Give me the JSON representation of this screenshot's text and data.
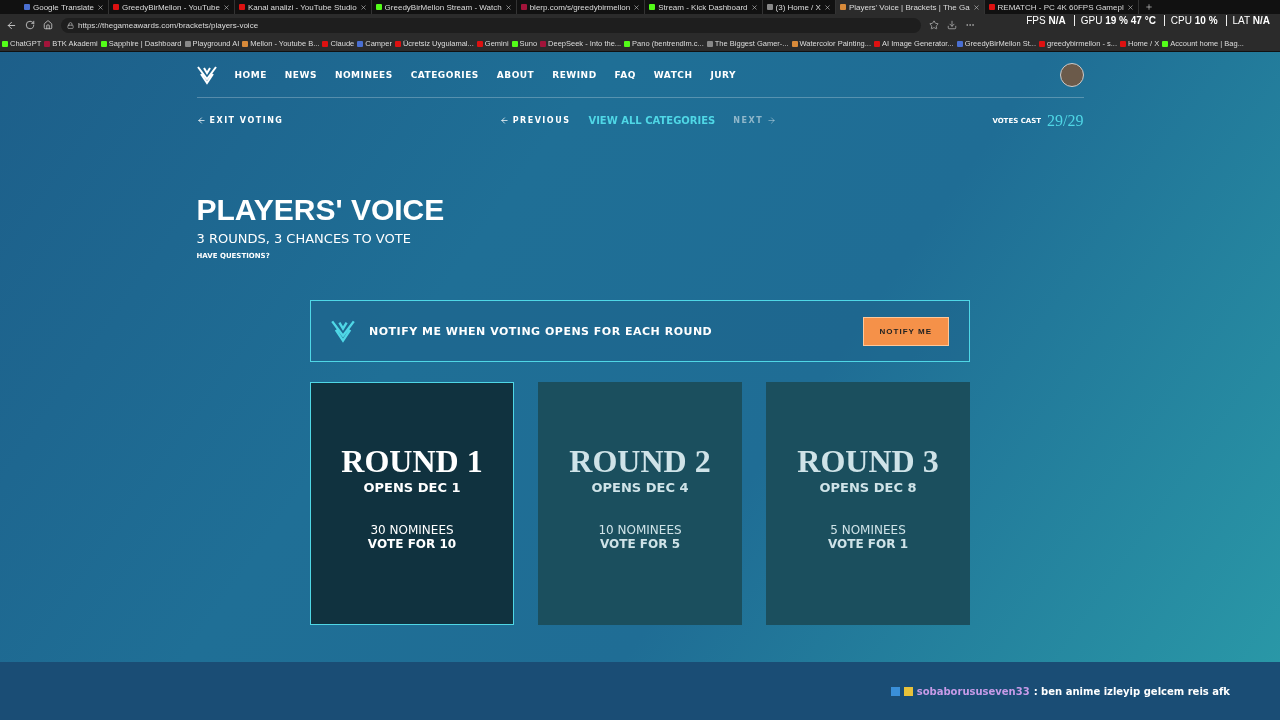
{
  "browser": {
    "tabs": [
      {
        "title": "Google Translate",
        "selected": false
      },
      {
        "title": "GreedyBirMellon - YouTube",
        "selected": false
      },
      {
        "title": "Kanal analizi - YouTube Studio",
        "selected": false
      },
      {
        "title": "GreedyBirMellon Stream - Watch",
        "selected": false
      },
      {
        "title": "blerp.com/s/greedybirmellon",
        "selected": false
      },
      {
        "title": "Stream - Kick Dashboard",
        "selected": false
      },
      {
        "title": "(3) Home / X",
        "selected": false
      },
      {
        "title": "Players' Voice | Brackets | The Ga",
        "selected": true
      },
      {
        "title": "REMATCH - PC 4K 60FPS Gamepl",
        "selected": false
      }
    ],
    "address": "https://thegameawards.com/brackets/players-voice",
    "bookmarks": [
      "ChatGPT",
      "BTK Akademi",
      "Sapphire | Dashboard",
      "Playground AI",
      "Mellon - Youtube B...",
      "Claude",
      "Camper",
      "Ücretsiz Uygulamal...",
      "Gemini",
      "Suno",
      "DeepSeek - Into the...",
      "Pano (bentrendlm.c...",
      "The Biggest Gamer-...",
      "Watercolor Painting...",
      "AI Image Generator...",
      "GreedyBirMellon St...",
      "greedybirmellon - s...",
      "Home / X",
      "Account home | Bag..."
    ]
  },
  "overlay": [
    {
      "label": "FPS",
      "value": "N/A"
    },
    {
      "label": "GPU",
      "value": "19 %  47 °C"
    },
    {
      "label": "CPU",
      "value": "10 %"
    },
    {
      "label": "LAT",
      "value": "N/A"
    }
  ],
  "nav": [
    "HOME",
    "NEWS",
    "NOMINEES",
    "CATEGORIES",
    "ABOUT",
    "REWIND",
    "FAQ",
    "WATCH",
    "JURY"
  ],
  "subnav": {
    "exit": "EXIT VOTING",
    "previous": "PREVIOUS",
    "all": "VIEW ALL CATEGORIES",
    "next": "NEXT",
    "next_disabled": true,
    "votes_label": "VOTES CAST",
    "votes": "29/29"
  },
  "hero": {
    "title": "PLAYERS' VOICE",
    "subtitle": "3 ROUNDS, 3 CHANCES TO VOTE",
    "link": "HAVE QUESTIONS?"
  },
  "notify": {
    "text": "NOTIFY ME WHEN VOTING OPENS FOR EACH ROUND",
    "button": "NOTIFY ME"
  },
  "rounds": [
    {
      "title": "ROUND 1",
      "opens": "OPENS DEC 1",
      "nominees": "30 NOMINEES",
      "vote": "VOTE FOR 10",
      "selected": true
    },
    {
      "title": "ROUND 2",
      "opens": "OPENS DEC 4",
      "nominees": "10 NOMINEES",
      "vote": "VOTE FOR 5",
      "selected": false
    },
    {
      "title": "ROUND 3",
      "opens": "OPENS DEC 8",
      "nominees": "5 NOMINEES",
      "vote": "VOTE FOR 1",
      "selected": false
    }
  ],
  "chat": {
    "user": "sobaborususeven33",
    "message": ": ben anime izleyip gelcem reis afk"
  }
}
